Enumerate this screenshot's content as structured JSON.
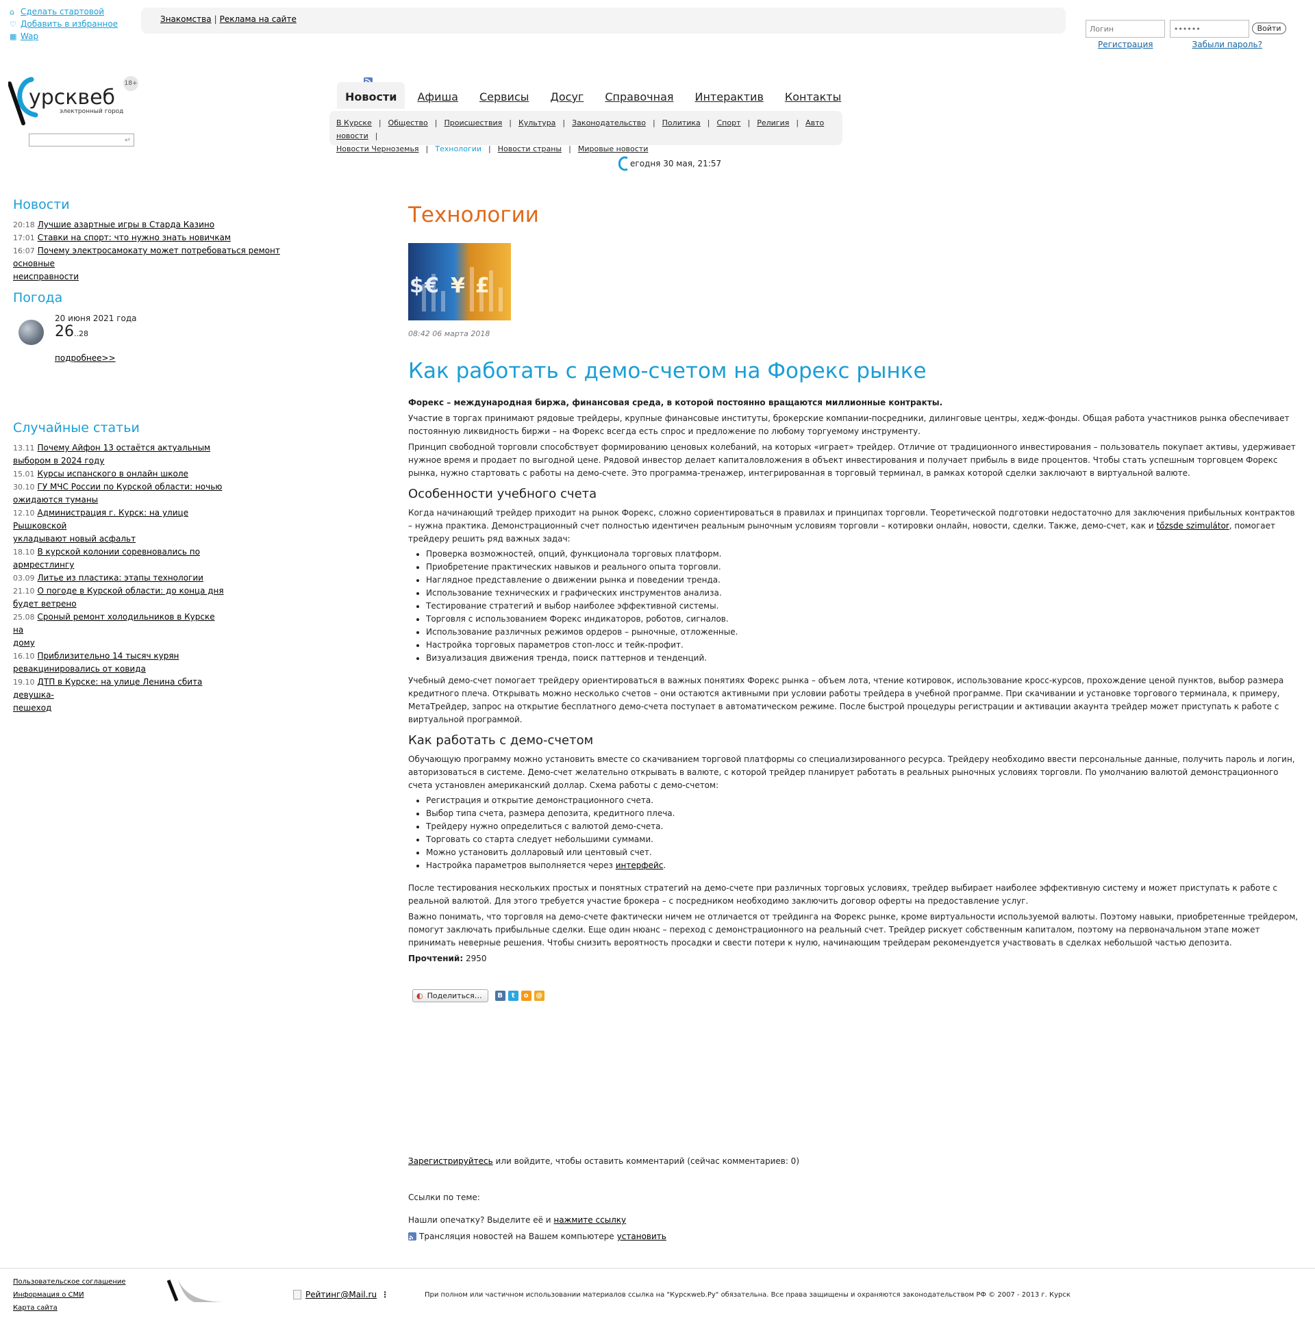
{
  "util": {
    "items": [
      {
        "icon": "home-icon",
        "label": "Сделать стартовой"
      },
      {
        "icon": "heart-icon",
        "label": "Добавить в избранное"
      },
      {
        "icon": "phone-icon",
        "label": "Wap"
      }
    ]
  },
  "topbar": {
    "link1": "Знакомства",
    "link2": "Реклама на сайте"
  },
  "login": {
    "login_placeholder": "Логин",
    "password_value": "••••••",
    "submit": "Войти",
    "register": "Регистрация",
    "forgot": "Забыли пароль?"
  },
  "logo": {
    "title": "урсквеб",
    "subtitle": "электронный город",
    "age": "18+"
  },
  "nav": {
    "items": [
      "Новости",
      "Афиша",
      "Сервисы",
      "Досуг",
      "Справочная",
      "Интерактив",
      "Контакты"
    ],
    "sub_row1": [
      "В Курске",
      "Общество",
      "Происшествия",
      "Культура",
      "Законодательство",
      "Политика",
      "Спорт",
      "Религия",
      "Авто новости"
    ],
    "sub_row2": [
      "Новости Черноземья",
      "Технологии",
      "Новости страны",
      "Мировые новости"
    ]
  },
  "today": "егодня 30 мая, 21:57",
  "left": {
    "news_title": "Новости",
    "news": [
      {
        "time": "20:18",
        "text": "Лучшие азартные игры в Старда Казино"
      },
      {
        "time": "17:01",
        "text": "Ставки на спорт: что нужно знать новичкам"
      },
      {
        "time": "16:07",
        "text": "Почему электросамокату может потребоваться ремонт основные"
      },
      {
        "text": "неисправности"
      }
    ],
    "weather_title": "Погода",
    "weather_date": "20 июня 2021 года",
    "weather_temp": "26",
    "weather_temp2": "..28",
    "weather_more": "подробнее>>",
    "random_title": "Случайные статьи",
    "random": [
      {
        "date": "13.11",
        "l1": "Почему Айфон 13 остаётся актуальным",
        "l2": "выбором в 2024 году"
      },
      {
        "date": "15.01",
        "l1": "Курсы испанского в онлайн школе",
        "l2": ""
      },
      {
        "date": "30.10",
        "l1": "ГУ МЧС России по Курской области: ночью",
        "l2": "ожидаются туманы"
      },
      {
        "date": "12.10",
        "l1": "Администрация г. Курск: на улице Рышковской",
        "l2": "укладывают новый асфальт"
      },
      {
        "date": "18.10",
        "l1": "В курской колонии соревновались по",
        "l2": "армрестлингу"
      },
      {
        "date": "03.09",
        "l1": "Литье из пластика: этапы технологии",
        "l2": ""
      },
      {
        "date": "21.10",
        "l1": "О погоде в Курской области: до конца дня",
        "l2": "будет ветрено"
      },
      {
        "date": "25.08",
        "l1": "Сроный ремонт холодильников в Курске на",
        "l2": "дому"
      },
      {
        "date": "16.10",
        "l1": "Приблизительно 14 тысяч курян",
        "l2": "ревакцинировались от ковида"
      },
      {
        "date": "19.10",
        "l1": "ДТП в Курске: на улице Ленина сбита девушка-",
        "l2": "пешеход"
      }
    ]
  },
  "article": {
    "category": "Технологии",
    "pubdate": "08:42 06 марта 2018",
    "title": "Как работать с демо-счетом на Форекс рынке",
    "lead": "Форекс – международная биржа, финансовая среда, в которой постоянно вращаются миллионные контракты.",
    "p1": "Участие в торгах принимают рядовые трейдеры, крупные финансовые институты, брокерские компании-посредники, дилинговые центры, хедж-фонды. Общая работа участников рынка обеспечивает постоянную ликвидность биржи – на Форекс всегда есть спрос и предложение по любому торгуемому инструменту.",
    "p2": "Принцип свободной торговли способствует формированию ценовых колебаний, на которых «играет» трейдер. Отличие от традиционного инвестирования – пользователь покупает активы, удерживает нужное время и продает по выгодной цене. Рядовой инвестор делает капиталовложения в объект инвестирования и получает прибыль в виде процентов. Чтобы стать успешным торговцем Форекс рынка, нужно стартовать с работы на демо-счете. Это программа-тренажер, интегрированная в торговый терминал, в рамках которой сделки заключают в виртуальной валюте.",
    "h2a": "Особенности учебного счета",
    "p3a": "Когда начинающий трейдер приходит на рынок Форекс, сложно сориентироваться в правилах и принципах торговли. Теоретической подготовки недостаточно для заключения прибыльных контрактов – нужна практика. Демонстрационный счет полностью идентичен реальным рыночным условиям торговли – котировки онлайн, новости, сделки. Также, демо-счет, как и ",
    "p3link": "tőzsde szimulátor",
    "p3b": ", помогает трейдеру решить ряд важных задач:",
    "list1": [
      "Проверка возможностей, опций, функционала торговых платформ.",
      "Приобретение практических навыков и реального опыта торговли.",
      "Наглядное представление о движении рынка и поведении тренда.",
      "Использование технических и графических инструментов анализа.",
      "Тестирование стратегий и выбор наиболее эффективной системы.",
      "Торговля с использованием Форекс индикаторов, роботов, сигналов.",
      "Использование различных режимов ордеров – рыночные, отложенные.",
      "Настройка торговых параметров стоп-лосс и тейк-профит.",
      "Визуализация движения тренда, поиск паттернов и тенденций."
    ],
    "p4": "Учебный демо-счет помогает трейдеру ориентироваться в важных понятиях Форекс рынка – объем лота, чтение котировок, использование кросс-курсов, прохождение ценой пунктов, выбор размера кредитного плеча. Открывать можно несколько счетов – они остаются активными при условии работы трейдера в учебной программе. При скачивании и установке торгового терминала, к примеру, МетаТрейдер, запрос на открытие бесплатного демо-счета поступает в автоматическом режиме. После быстрой процедуры регистрации и активации акаунта трейдер может приступать к работе с виртуальной программой.",
    "h2b": "Как работать с демо-счетом",
    "p5": "Обучающую программу можно установить вместе со скачиванием торговой платформы со специализированного ресурса. Трейдеру необходимо ввести персональные данные, получить пароль и логин, авторизоваться в системе. Демо-счет желательно открывать в валюте, с которой трейдер планирует работать в реальных рыночных условиях торговли. По умолчанию валютой демонстрационного счета установлен американский доллар. Схема работы с демо-счетом:",
    "list2": [
      "Регистрация и открытие демонстрационного счета.",
      "Выбор типа счета, размера депозита, кредитного плеча.",
      "Трейдеру нужно определиться с валютой демо-счета.",
      "Торговать со старта следует небольшими суммами.",
      "Можно установить долларовый или центовый счет."
    ],
    "list2_last_a": "Настройка параметров выполняется через ",
    "list2_last_link": "интерфейс",
    "list2_last_b": ".",
    "p6": "После тестирования нескольких простых и понятных стратегий на демо-счете при различных торговых условиях, трейдер выбирает наиболее эффективную систему и может приступать к работе с реальной валютой. Для этого требуется участие брокера – с посредником необходимо заключить договор оферты на предоставление услуг.",
    "p7": "Важно понимать, что торговля на демо-счете фактически ничем не отличается от трейдинга на Форекс рынке, кроме виртуальности используемой валюты. Поэтому навыки, приобретенные трейдером, помогут заключать прибыльные сделки. Еще один нюанс – переход с демонстрационного на реальный счет. Трейдер рискует собственным капиталом, поэтому на первоначальном этапе может принимать неверные решения. Чтобы снизить вероятность просадки и свести потери к нулю, начинающим трейдерам рекомендуется участвовать в сделках небольшой частью депозита.",
    "reads_label": "Прочтений:",
    "reads_value": "2950",
    "share_label": "Поделиться…",
    "share_icons": [
      "В",
      "t",
      "о",
      "@"
    ],
    "comments_link": "Зарегистрируйтесь",
    "comments_text": " или войдите, чтобы оставить комментарий (сейчас комментариев: 0)",
    "related": "Ссылки по теме:",
    "typo_text": "Нашли опечатку? Выделите её и ",
    "typo_link": "нажмите ссылку",
    "rss_text": "Трансляция новостей на Вашем компьютере ",
    "rss_link": "установить"
  },
  "footer": {
    "links": [
      "Пользовательское соглашение",
      "Информация о СМИ",
      "Карта сайта"
    ],
    "rating": "Рейтинг@Mail.ru",
    "copyright": "При полном или частичном использовании материалов ссылка на \"Курскweb.Ру\" обязательна. Все права защищены и охраняются законодательством РФ © 2007 - 2013 г. Курск"
  },
  "colors": {
    "accent": "#1a9ed6",
    "category": "#e06a1b"
  }
}
